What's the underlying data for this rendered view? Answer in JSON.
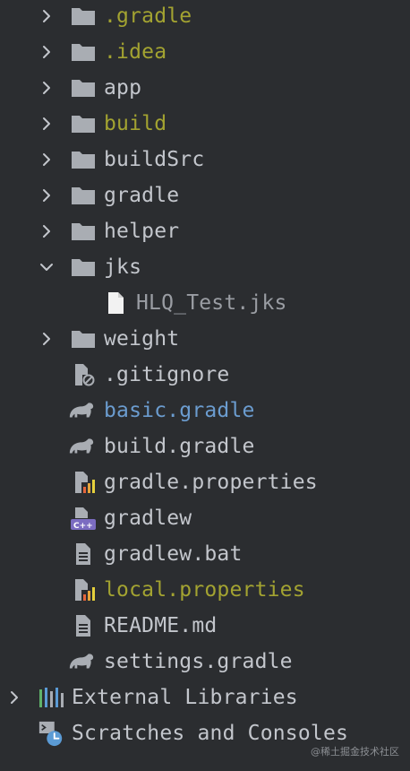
{
  "colors": {
    "background": "#2b2d30",
    "text_default": "#c3c6cc",
    "text_ignored": "#a3a331",
    "text_modified_blue": "#6b9ccf",
    "text_excluded": "#9a9da3",
    "folder_icon": "#a9adb3",
    "chevron": "#c3c6cc"
  },
  "tree": {
    "items": [
      {
        "label": ".gradle",
        "icon": "folder-icon",
        "expanded": false,
        "color": "ignored"
      },
      {
        "label": ".idea",
        "icon": "folder-icon",
        "expanded": false,
        "color": "ignored"
      },
      {
        "label": "app",
        "icon": "folder-icon",
        "expanded": false,
        "color": "default"
      },
      {
        "label": "build",
        "icon": "folder-icon",
        "expanded": false,
        "color": "ignored"
      },
      {
        "label": "buildSrc",
        "icon": "folder-icon",
        "expanded": false,
        "color": "default"
      },
      {
        "label": "gradle",
        "icon": "folder-icon",
        "expanded": false,
        "color": "default"
      },
      {
        "label": "helper",
        "icon": "folder-icon",
        "expanded": false,
        "color": "default"
      },
      {
        "label": "jks",
        "icon": "folder-icon",
        "expanded": true,
        "color": "default"
      },
      {
        "label": "HLQ_Test.jks",
        "icon": "file-icon",
        "color": "excluded"
      },
      {
        "label": "weight",
        "icon": "folder-icon",
        "expanded": false,
        "color": "default"
      },
      {
        "label": ".gitignore",
        "icon": "gitignore-file-icon",
        "color": "default"
      },
      {
        "label": "basic.gradle",
        "icon": "gradle-elephant-icon",
        "color": "blue"
      },
      {
        "label": "build.gradle",
        "icon": "gradle-elephant-icon",
        "color": "default"
      },
      {
        "label": "gradle.properties",
        "icon": "properties-file-icon",
        "color": "default"
      },
      {
        "label": "gradlew",
        "icon": "cpp-file-icon",
        "color": "default"
      },
      {
        "label": "gradlew.bat",
        "icon": "text-file-icon",
        "color": "default"
      },
      {
        "label": "local.properties",
        "icon": "properties-file-icon",
        "color": "ignored"
      },
      {
        "label": "README.md",
        "icon": "markdown-file-icon",
        "color": "default"
      },
      {
        "label": "settings.gradle",
        "icon": "gradle-elephant-icon",
        "color": "default"
      }
    ],
    "external_libraries": "External Libraries",
    "scratches": "Scratches and Consoles"
  },
  "watermark": "@稀土掘金技术社区"
}
